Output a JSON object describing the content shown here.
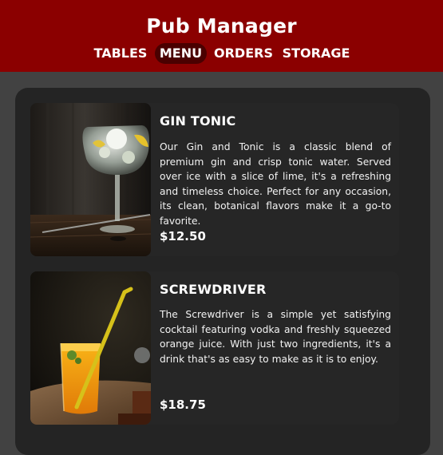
{
  "app": {
    "title": "Pub Manager"
  },
  "nav": {
    "items": [
      {
        "label": "TABLES",
        "active": false
      },
      {
        "label": "MENU",
        "active": true
      },
      {
        "label": "ORDERS",
        "active": false
      },
      {
        "label": "STORAGE",
        "active": false
      }
    ]
  },
  "menu": {
    "items": [
      {
        "name": "GIN TONIC",
        "description": "Our Gin and Tonic is a classic blend of premium gin and crisp tonic water. Served over ice with a slice of lime, it's a refreshing and timeless choice. Perfect for any occasion, its clean, botanical flavors make it a go-to favorite.",
        "price": "$12.50"
      },
      {
        "name": "SCREWDRIVER",
        "description": "The Screwdriver is a simple yet satisfying cocktail featuring vodka and freshly squeezed orange juice. With just two ingredients, it's a drink that's as easy to make as it is to enjoy.",
        "price": "$18.75"
      }
    ]
  },
  "colors": {
    "header_bg": "#8b0000",
    "active_tab_bg": "#4a0000",
    "page_bg": "#424242",
    "panel_bg": "#242424"
  }
}
